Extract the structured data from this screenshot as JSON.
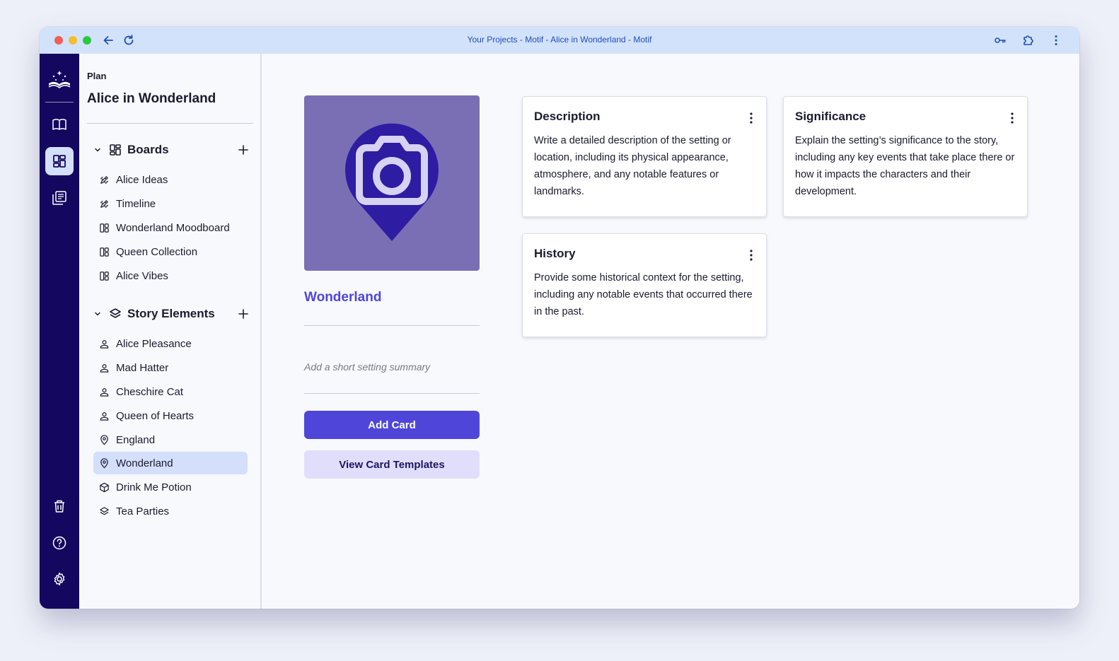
{
  "window": {
    "title": "Your Projects - Motif - Alice in Wonderland - Motif"
  },
  "sidebar": {
    "section_label": "Plan",
    "project_title": "Alice in Wonderland",
    "boards": {
      "label": "Boards",
      "items": [
        {
          "label": "Alice Ideas",
          "icon": "pencil-ruler-icon"
        },
        {
          "label": "Timeline",
          "icon": "pencil-ruler-icon"
        },
        {
          "label": "Wonderland Moodboard",
          "icon": "board-layout-icon"
        },
        {
          "label": "Queen Collection",
          "icon": "board-layout-icon"
        },
        {
          "label": "Alice Vibes",
          "icon": "board-layout-icon"
        }
      ]
    },
    "story_elements": {
      "label": "Story Elements",
      "items": [
        {
          "label": "Alice Pleasance",
          "icon": "person-icon"
        },
        {
          "label": "Mad Hatter",
          "icon": "person-icon"
        },
        {
          "label": "Cheschire Cat",
          "icon": "person-icon"
        },
        {
          "label": "Queen of Hearts",
          "icon": "person-icon"
        },
        {
          "label": "England",
          "icon": "location-pin-icon"
        },
        {
          "label": "Wonderland",
          "icon": "location-pin-icon",
          "selected": true
        },
        {
          "label": "Drink Me Potion",
          "icon": "cube-icon"
        },
        {
          "label": "Tea Parties",
          "icon": "layers-icon"
        }
      ]
    }
  },
  "setting": {
    "name": "Wonderland",
    "summary_placeholder": "Add a short setting summary",
    "add_card_label": "Add Card",
    "view_templates_label": "View Card Templates"
  },
  "cards": [
    {
      "title": "Description",
      "body": "Write a detailed description of the setting or location, including its physical appearance, atmosphere, and any notable features or landmarks."
    },
    {
      "title": "Significance",
      "body": "Explain the setting’s significance to the story, including any key events that take place there or how it impacts the characters and their development."
    },
    {
      "title": "History",
      "body": "Provide some historical context for the setting, including any notable events that occurred there in the past."
    }
  ],
  "colors": {
    "accent": "#4f46d9",
    "rail": "#14075f",
    "selected": "#d3dffb",
    "titlebar": "#d3e2fb"
  }
}
